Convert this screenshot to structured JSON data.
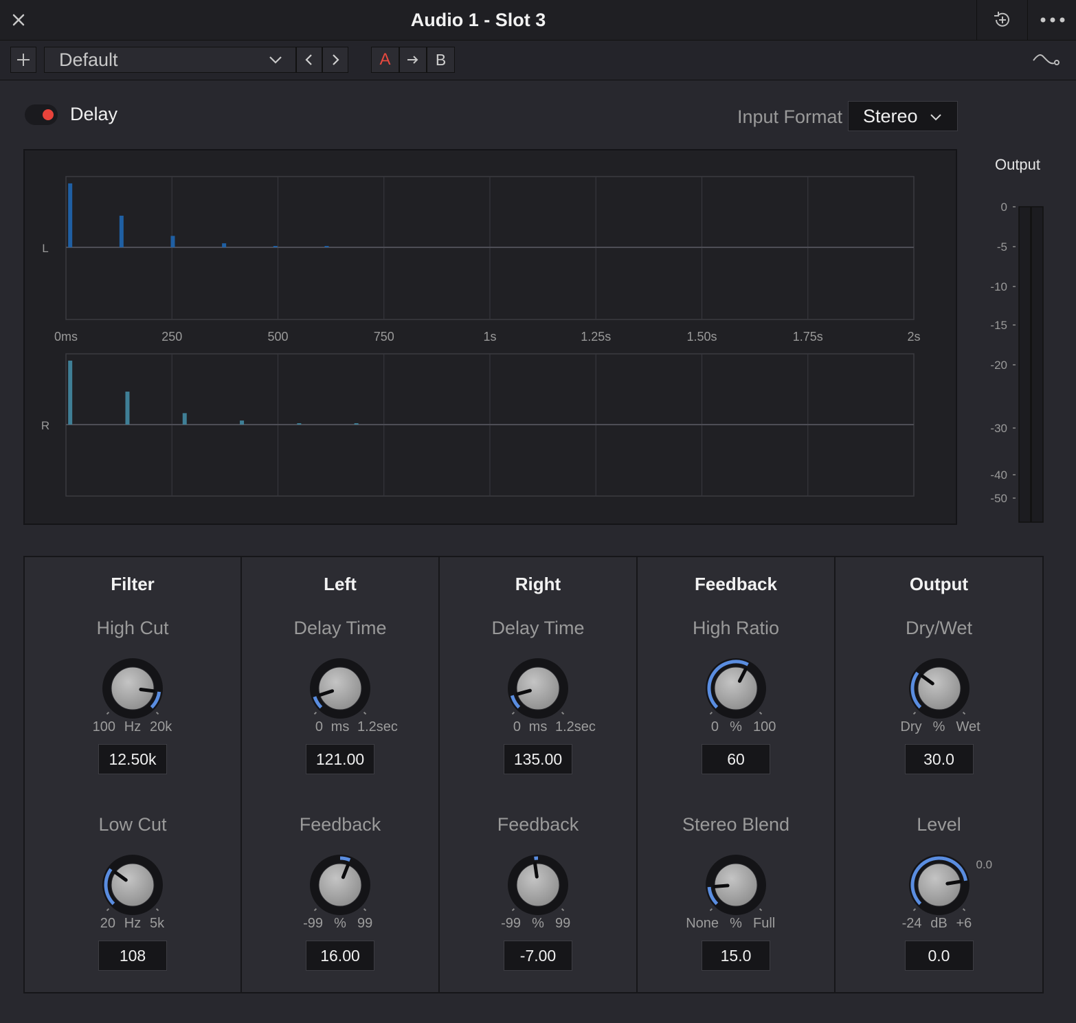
{
  "window": {
    "title": "Audio 1 - Slot 3"
  },
  "toolbar": {
    "preset": "Default",
    "ab": {
      "a": "A",
      "b": "B"
    }
  },
  "plugin": {
    "name": "Delay",
    "enabled": true,
    "input_format_label": "Input Format",
    "input_format_value": "Stereo"
  },
  "colors": {
    "accent_red": "#e8433b",
    "knob_arc_blue": "#5a8de0",
    "tap_left": "#1f5fa3",
    "tap_right": "#3f7f96"
  },
  "graph": {
    "channels": [
      "L",
      "R"
    ],
    "time_ticks": [
      "0ms",
      "250",
      "500",
      "750",
      "1s",
      "1.25s",
      "1.50s",
      "1.75s",
      "2s"
    ],
    "time_max_ms": 2000,
    "left_taps": [
      {
        "t": 10,
        "level": 0.95
      },
      {
        "t": 131,
        "level": 0.47
      },
      {
        "t": 252,
        "level": 0.17
      },
      {
        "t": 373,
        "level": 0.06
      },
      {
        "t": 494,
        "level": 0.02
      },
      {
        "t": 615,
        "level": 0.01
      }
    ],
    "right_taps": [
      {
        "t": 10,
        "level": 0.95
      },
      {
        "t": 145,
        "level": 0.49
      },
      {
        "t": 280,
        "level": 0.17
      },
      {
        "t": 415,
        "level": 0.06
      },
      {
        "t": 550,
        "level": 0.02
      },
      {
        "t": 685,
        "level": 0.01
      }
    ]
  },
  "meter": {
    "title": "Output",
    "scale": [
      "0",
      "-5",
      "-10",
      "-15",
      "-20",
      "-30",
      "-40",
      "-50"
    ]
  },
  "sections": [
    {
      "title": "Filter",
      "controls": [
        {
          "label": "High Cut",
          "min": "100",
          "unit": "Hz",
          "max": "20k",
          "value": "12.50k",
          "position": 0.86,
          "arc": "from-max"
        },
        {
          "label": "Low Cut",
          "min": "20",
          "unit": "Hz",
          "max": "5k",
          "value": "108",
          "position": 0.3,
          "arc": "from-min"
        }
      ]
    },
    {
      "title": "Left",
      "controls": [
        {
          "label": "Delay Time",
          "min": "0",
          "unit": "ms",
          "max": "1.2sec",
          "value": "121.00",
          "position": 0.1,
          "arc": "from-min"
        },
        {
          "label": "Feedback",
          "min": "-99",
          "unit": "%",
          "max": "99",
          "value": "16.00",
          "position": 0.58,
          "arc": "from-center"
        }
      ]
    },
    {
      "title": "Right",
      "controls": [
        {
          "label": "Delay Time",
          "min": "0",
          "unit": "ms",
          "max": "1.2sec",
          "value": "135.00",
          "position": 0.11,
          "arc": "from-min"
        },
        {
          "label": "Feedback",
          "min": "-99",
          "unit": "%",
          "max": "99",
          "value": "-7.00",
          "position": 0.47,
          "arc": "from-center"
        }
      ]
    },
    {
      "title": "Feedback",
      "controls": [
        {
          "label": "High Ratio",
          "min": "0",
          "unit": "%",
          "max": "100",
          "value": "60",
          "position": 0.6,
          "arc": "from-min"
        },
        {
          "label": "Stereo Blend",
          "min": "None",
          "unit": "%",
          "max": "Full",
          "value": "15.0",
          "position": 0.15,
          "arc": "from-min"
        }
      ]
    },
    {
      "title": "Output",
      "controls": [
        {
          "label": "Dry/Wet",
          "min": "Dry",
          "unit": "%",
          "max": "Wet",
          "value": "30.0",
          "position": 0.3,
          "arc": "from-min"
        },
        {
          "label": "Level",
          "min": "-24",
          "unit": "dB",
          "max": "+6",
          "value": "0.0",
          "position": 0.8,
          "arc": "from-min",
          "readout": "0.0"
        }
      ]
    }
  ]
}
